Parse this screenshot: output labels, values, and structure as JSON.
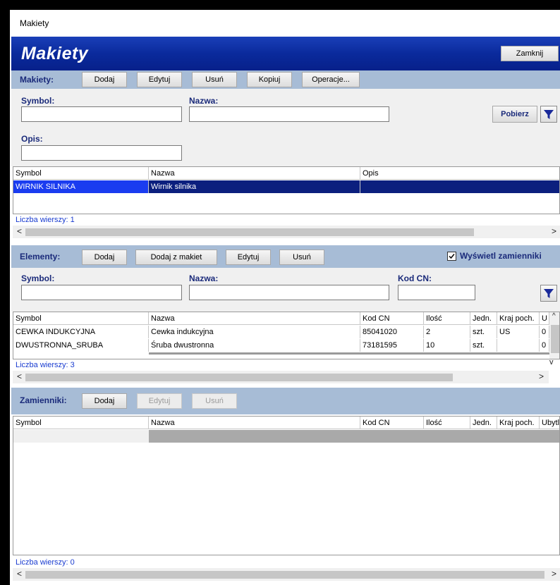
{
  "window": {
    "title": "Makiety"
  },
  "header": {
    "brand": "Makiety",
    "close_label": "Zamknij"
  },
  "makiety": {
    "bar_label": "Makiety:",
    "buttons": [
      "Dodaj",
      "Edytuj",
      "Usuń",
      "Kopiuj",
      "Operacje..."
    ],
    "symbol_label": "Symbol:",
    "name_label": "Nazwa:",
    "desc_label": "Opis:",
    "symbol_value": "",
    "name_value": "",
    "desc_value": "",
    "fetch_label": "Pobierz",
    "columns": [
      "Symbol",
      "Nazwa",
      "Opis"
    ],
    "rows": [
      {
        "symbol": "WIRNIK SILNIKA",
        "name": "Wirnik silnika",
        "desc": ""
      }
    ],
    "count_label": "Liczba wierszy: 1"
  },
  "elementy": {
    "bar_label": "Elementy:",
    "buttons": [
      "Dodaj",
      "Dodaj z makiet",
      "Edytuj",
      "Usuń"
    ],
    "show_substitutes_label": "Wyświetl zamienniki",
    "show_substitutes_checked": true,
    "symbol_label": "Symbol:",
    "name_label": "Nazwa:",
    "cn_label": "Kod CN:",
    "columns": [
      "Symbol",
      "Nazwa",
      "Kod CN",
      "Ilość",
      "Jedn.",
      "Kraj poch.",
      "U"
    ],
    "rows": [
      {
        "symbol": "CEWKA INDUKCYJNA",
        "name": "Cewka indukcyjna",
        "cn": "85041020",
        "qty": "2",
        "unit": "szt.",
        "country": "US",
        "u": "0"
      },
      {
        "symbol": "DWUSTRONNA_SRUBA",
        "name": "Śruba dwustronna",
        "cn": "73181595",
        "qty": "10",
        "unit": "szt.",
        "country": "",
        "u": "0"
      }
    ],
    "count_label": "Liczba wierszy: 3"
  },
  "zamienniki": {
    "bar_label": "Zamienniki:",
    "buttons": [
      "Dodaj",
      "Edytuj",
      "Usuń"
    ],
    "columns": [
      "Symbol",
      "Nazwa",
      "Kod CN",
      "Ilość",
      "Jedn.",
      "Kraj poch.",
      "Ubytl"
    ],
    "count_label": "Liczba wierszy: 0"
  },
  "scroll_arrows": {
    "left": "<",
    "right": ">",
    "up": "^",
    "down": "v"
  }
}
